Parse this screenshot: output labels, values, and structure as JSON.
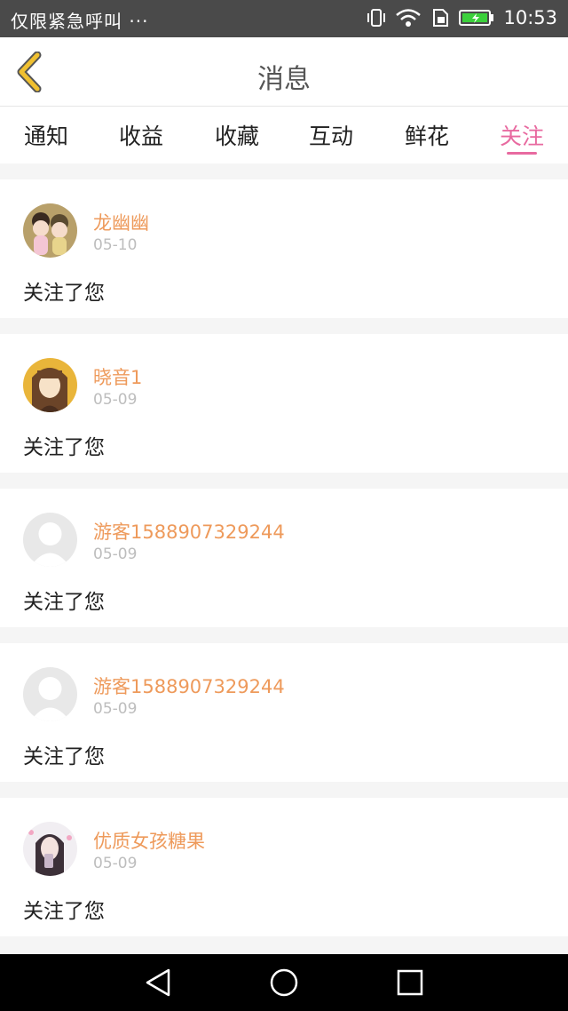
{
  "status_bar": {
    "carrier_text": "仅限紧急呼叫 ···",
    "time": "10:53",
    "icons": [
      "vibrate-icon",
      "wifi-icon",
      "sim-icon",
      "battery-charging-icon"
    ]
  },
  "header": {
    "title": "消息",
    "back_icon": "chevron-left-icon"
  },
  "tabs": [
    {
      "label": "通知",
      "active": false
    },
    {
      "label": "收益",
      "active": false
    },
    {
      "label": "收藏",
      "active": false
    },
    {
      "label": "互动",
      "active": false
    },
    {
      "label": "鲜花",
      "active": false
    },
    {
      "label": "关注",
      "active": true
    }
  ],
  "messages": [
    {
      "name": "龙幽幽",
      "date": "05-10",
      "text": "关注了您",
      "avatar": "cartoon-couple-avatar"
    },
    {
      "name": "晓音1",
      "date": "05-09",
      "text": "关注了您",
      "avatar": "anime-girl-avatar"
    },
    {
      "name": "游客1588907329244",
      "date": "05-09",
      "text": "关注了您",
      "avatar": "default-avatar"
    },
    {
      "name": "游客1588907329244",
      "date": "05-09",
      "text": "关注了您",
      "avatar": "default-avatar"
    },
    {
      "name": "优质女孩糖果",
      "date": "05-09",
      "text": "关注了您",
      "avatar": "photo-girl-avatar"
    }
  ],
  "colors": {
    "accent": "#e86aa0",
    "username": "#ee9a5b",
    "back_icon": "#f0c030"
  },
  "nav_bar": {
    "buttons": [
      "back-triangle-icon",
      "home-circle-icon",
      "recents-square-icon"
    ]
  }
}
